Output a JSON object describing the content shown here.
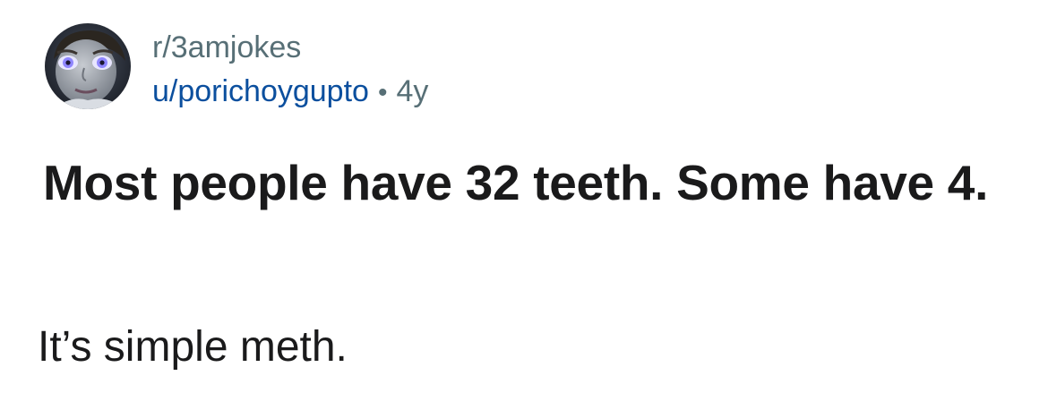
{
  "post": {
    "subreddit": "r/3amjokes",
    "author": "u/porichoygupto",
    "separator": "•",
    "age": "4y",
    "title": "Most people have 32 teeth. Some have 4.",
    "body": "It’s simple meth."
  },
  "avatar": {
    "icon": "cartoon-face-avatar",
    "colors": {
      "background": "#2a2f3a",
      "skin": "#9aa0a8",
      "eye_glow": "#8f86ff"
    }
  },
  "colors": {
    "subreddit": "#576f76",
    "username": "#0b4f9e",
    "title": "#1a1a1b",
    "body": "#1a1a1b"
  }
}
